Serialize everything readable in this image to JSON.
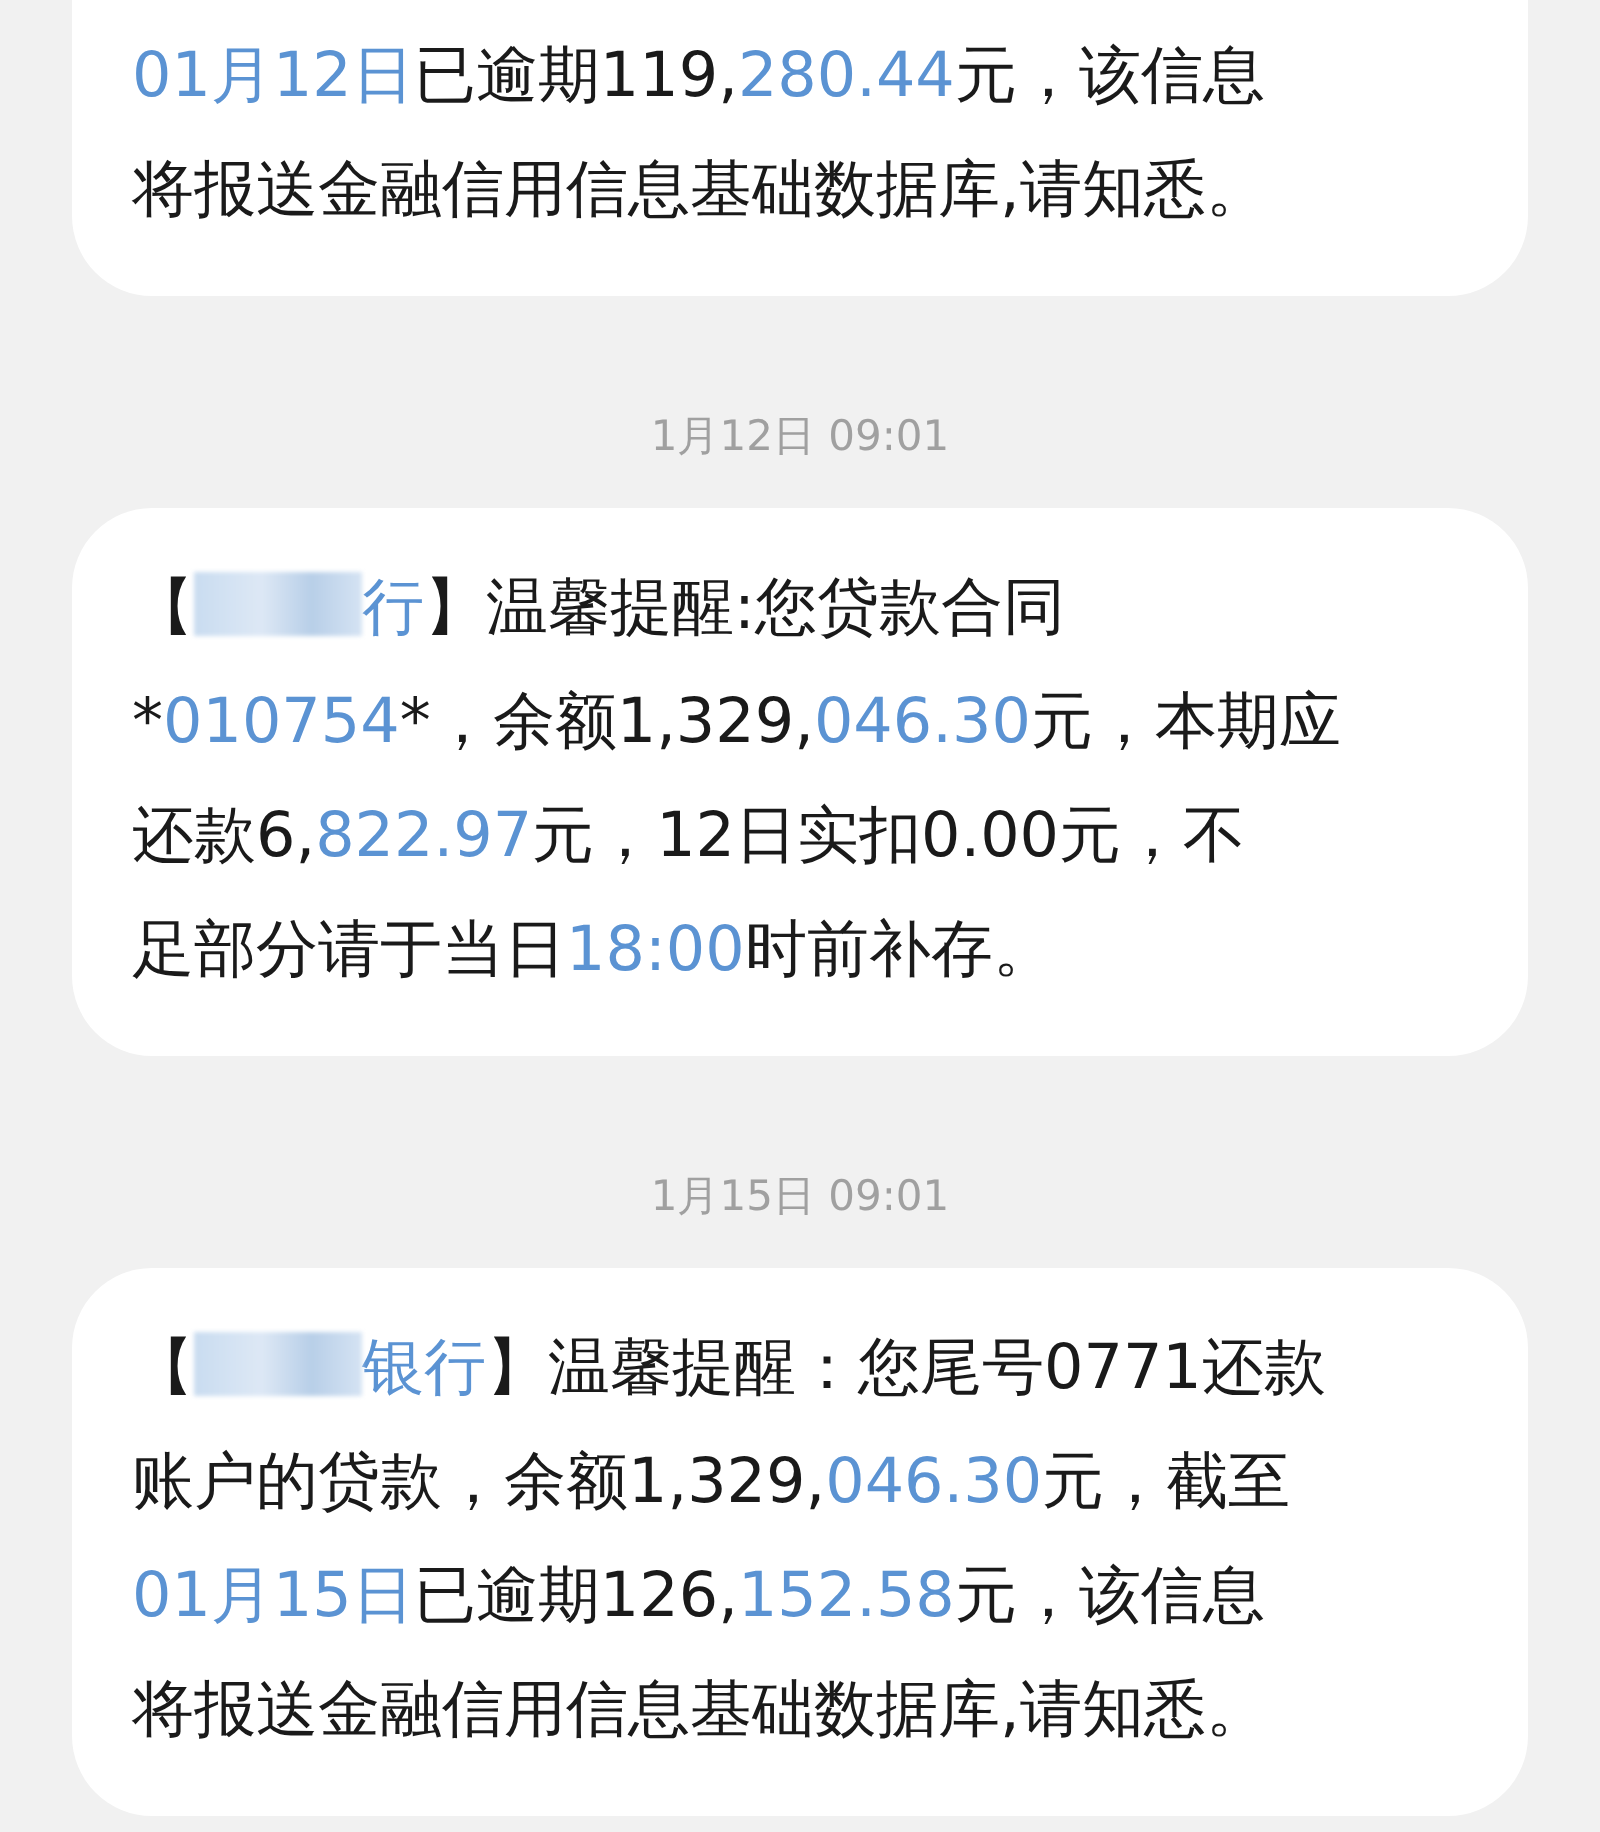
{
  "messages": [
    {
      "cut_top": true,
      "lines": [
        [
          {
            "kind": "link",
            "text": "01月12日"
          },
          {
            "kind": "text",
            "text": "已逾期119,"
          },
          {
            "kind": "link",
            "text": "280.44"
          },
          {
            "kind": "text",
            "text": "元，该信息"
          }
        ],
        [
          {
            "kind": "text",
            "text": "将报送金融信用信息基础数据库,请知悉。"
          }
        ]
      ]
    },
    {
      "time": "1月12日 09:01",
      "cut_top": false,
      "lines": [
        [
          {
            "kind": "text",
            "text": "【"
          },
          {
            "kind": "redacted"
          },
          {
            "kind": "link",
            "text": "行"
          },
          {
            "kind": "text",
            "text": "】温馨提醒:您贷款合同"
          }
        ],
        [
          {
            "kind": "text",
            "text": "*"
          },
          {
            "kind": "link",
            "text": "010754"
          },
          {
            "kind": "text",
            "text": "*，余额1,329,"
          },
          {
            "kind": "link",
            "text": "046.30"
          },
          {
            "kind": "text",
            "text": "元，本期应"
          }
        ],
        [
          {
            "kind": "text",
            "text": "还款6,"
          },
          {
            "kind": "link",
            "text": "822.97"
          },
          {
            "kind": "text",
            "text": "元，12日实扣0.00元，不"
          }
        ],
        [
          {
            "kind": "text",
            "text": "足部分请于当日"
          },
          {
            "kind": "link",
            "text": "18:00"
          },
          {
            "kind": "text",
            "text": "时前补存。"
          }
        ]
      ]
    },
    {
      "time": "1月15日 09:01",
      "cut_top": false,
      "lines": [
        [
          {
            "kind": "text",
            "text": "【"
          },
          {
            "kind": "redacted"
          },
          {
            "kind": "link",
            "text": "银行"
          },
          {
            "kind": "text",
            "text": "】温馨提醒：您尾号0771还款"
          }
        ],
        [
          {
            "kind": "text",
            "text": "账户的贷款，余额1,329,"
          },
          {
            "kind": "link",
            "text": "046.30"
          },
          {
            "kind": "text",
            "text": "元，截至"
          }
        ],
        [
          {
            "kind": "link",
            "text": "01月15日"
          },
          {
            "kind": "text",
            "text": "已逾期126,"
          },
          {
            "kind": "link",
            "text": "152.58"
          },
          {
            "kind": "text",
            "text": "元，该信息"
          }
        ],
        [
          {
            "kind": "text",
            "text": "将报送金融信用信息基础数据库,请知悉。"
          }
        ]
      ]
    }
  ]
}
